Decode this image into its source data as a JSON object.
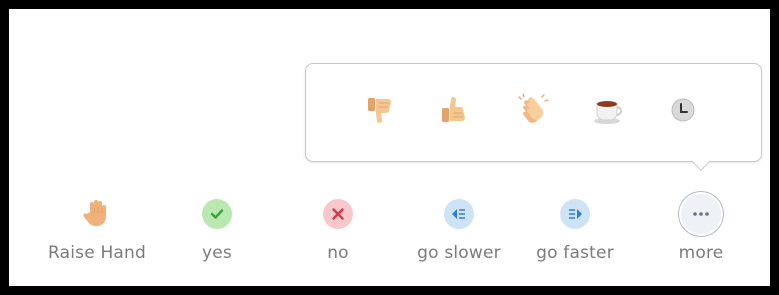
{
  "colors": {
    "frame": "#000000",
    "background": "#ffffff",
    "label": "#7b7b7b",
    "yes_bg": "#b9e8b1",
    "yes_fg": "#3aa53a",
    "no_bg": "#f7c9cc",
    "no_fg": "#d9364a",
    "speed_bg": "#cfe3f7",
    "speed_fg": "#2d7fd3",
    "skin": "#f4c690"
  },
  "reactions": [
    {
      "name": "thumbs-down",
      "icon": "thumbs-down-icon"
    },
    {
      "name": "thumbs-up",
      "icon": "thumbs-up-icon"
    },
    {
      "name": "clap",
      "icon": "clapping-hands-icon"
    },
    {
      "name": "coffee",
      "icon": "coffee-cup-icon"
    },
    {
      "name": "away",
      "icon": "clock-icon"
    }
  ],
  "toolbar": {
    "raise_hand": {
      "label": "Raise Hand",
      "icon": "raised-hand-icon"
    },
    "yes": {
      "label": "yes",
      "icon": "checkmark-icon"
    },
    "no": {
      "label": "no",
      "icon": "x-icon"
    },
    "go_slower": {
      "label": "go slower",
      "icon": "rewind-icon"
    },
    "go_faster": {
      "label": "go faster",
      "icon": "fast-forward-icon"
    },
    "more": {
      "label": "more",
      "icon": "ellipsis-icon"
    }
  }
}
